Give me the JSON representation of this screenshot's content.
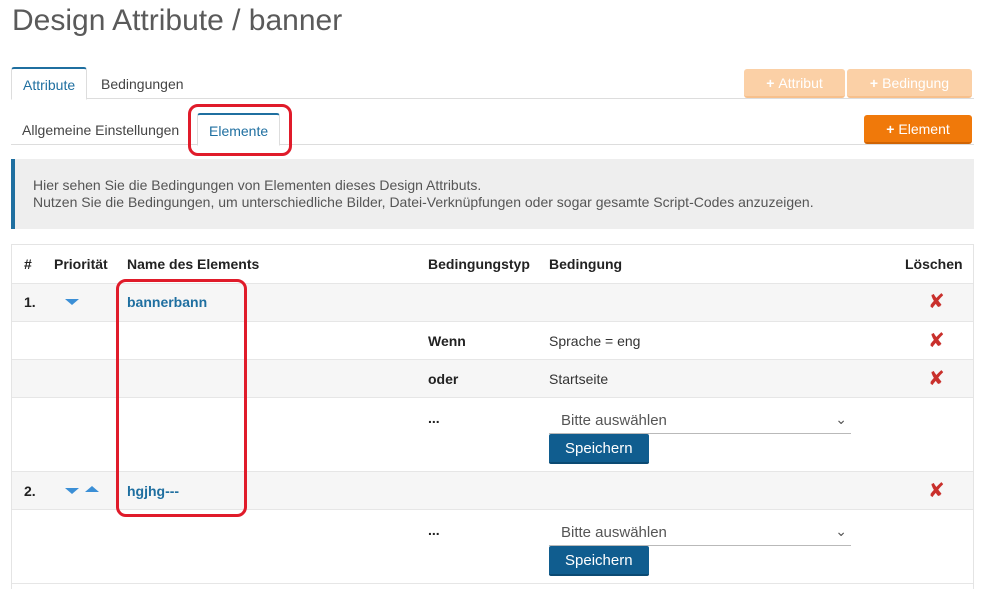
{
  "page": {
    "title": "Design Attribute / banner"
  },
  "tabs_main": [
    {
      "label": "Attribute"
    },
    {
      "label": "Bedingungen"
    }
  ],
  "actions": {
    "add_attribut": "Attribut",
    "add_bedingung": "Bedingung",
    "add_element": "Element"
  },
  "tabs_sub": [
    {
      "label": "Allgemeine Einstellungen"
    },
    {
      "label": "Elemente"
    }
  ],
  "info": {
    "line1": "Hier sehen Sie die Bedingungen von Elementen dieses Design Attributs.",
    "line2": "Nutzen Sie die Bedingungen, um unterschiedliche Bilder, Datei-Verknüpfungen oder sogar gesamte Script-Codes anzuzeigen."
  },
  "table": {
    "headers": {
      "num": "#",
      "priority": "Priorität",
      "name": "Name des Elements",
      "type": "Bedingungstyp",
      "condition": "Bedingung",
      "delete": "Löschen"
    },
    "rows": [
      {
        "num": "1.",
        "name": "bannerbann"
      },
      {
        "type": "Wenn",
        "condition": "Sprache = eng"
      },
      {
        "type": "oder",
        "condition": "Startseite"
      },
      {
        "type": "...",
        "select": "Bitte auswählen",
        "save": "Speichern"
      },
      {
        "num": "2.",
        "name": "hgjhg---"
      },
      {
        "type": "...",
        "select": "Bitte auswählen",
        "save": "Speichern"
      }
    ]
  },
  "colors": {
    "accent": "#1f6fa0",
    "orange": "#f0790a",
    "highlight": "#e01b2a",
    "delete": "#c9302c"
  },
  "icons": {
    "delete": "close-x-icon",
    "down": "arrow-down-icon",
    "up": "arrow-up-icon",
    "plus": "plus-icon"
  }
}
